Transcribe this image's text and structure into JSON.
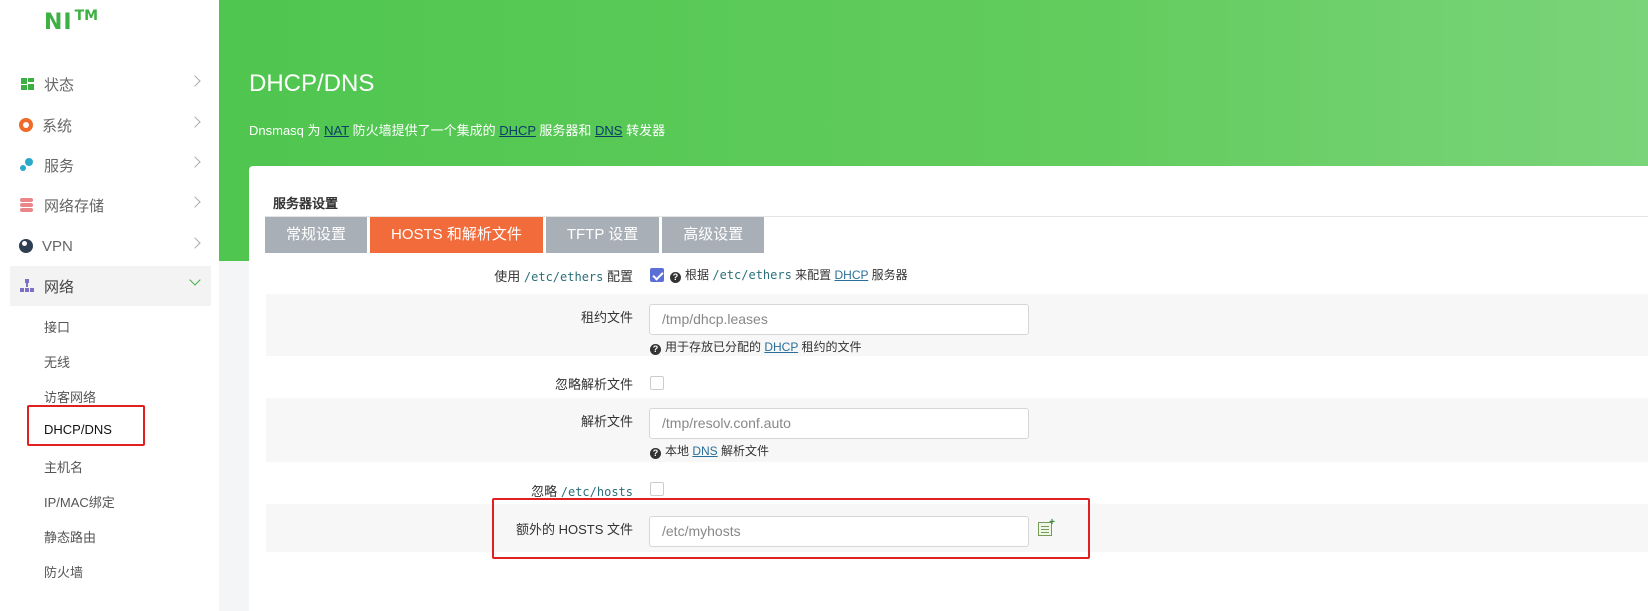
{
  "logo": {
    "text": "NI",
    "tm": "TM"
  },
  "sidebar": {
    "items": [
      {
        "label": "状态"
      },
      {
        "label": "系统"
      },
      {
        "label": "服务"
      },
      {
        "label": "网络存储"
      },
      {
        "label": "VPN"
      },
      {
        "label": "网络"
      }
    ],
    "network_sub": [
      {
        "label": "接口"
      },
      {
        "label": "无线"
      },
      {
        "label": "访客网络"
      },
      {
        "label": "DHCP/DNS"
      },
      {
        "label": "主机名"
      },
      {
        "label": "IP/MAC绑定"
      },
      {
        "label": "静态路由"
      },
      {
        "label": "防火墙"
      }
    ]
  },
  "header": {
    "title": "DHCP/DNS",
    "desc": {
      "p1": "Dnsmasq 为 ",
      "nat": "NAT",
      "p2": " 防火墙提供了一个集成的 ",
      "dhcp": "DHCP",
      "p3": " 服务器和 ",
      "dns": "DNS",
      "p4": " 转发器"
    }
  },
  "section": {
    "title": "服务器设置",
    "tabs": [
      {
        "label": "常规设置"
      },
      {
        "label": "HOSTS 和解析文件"
      },
      {
        "label": "TFTP 设置"
      },
      {
        "label": "高级设置"
      }
    ]
  },
  "form": {
    "ethers": {
      "label_pre": "使用 ",
      "label_path": "/etc/ethers",
      "label_post": " 配置",
      "help_pre": "根据 ",
      "help_path": "/etc/ethers",
      "help_mid": " 来配置 ",
      "help_link": "DHCP",
      "help_post": " 服务器",
      "checked": true
    },
    "leasefile": {
      "label": "租约文件",
      "placeholder": "/tmp/dhcp.leases",
      "help_pre": "用于存放已分配的 ",
      "help_link": "DHCP",
      "help_post": " 租约的文件"
    },
    "noresolv": {
      "label": "忽略解析文件",
      "checked": false
    },
    "resolvfile": {
      "label": "解析文件",
      "placeholder": "/tmp/resolv.conf.auto",
      "help_pre": "本地 ",
      "help_link": "DNS",
      "help_post": " 解析文件"
    },
    "nohosts": {
      "label_pre": "忽略 ",
      "label_path": "/etc/hosts",
      "checked": false
    },
    "addnhosts": {
      "label": "额外的 HOSTS 文件",
      "placeholder": "/etc/myhosts"
    }
  },
  "colors": {
    "brand_green": "#3cb043",
    "tab_active": "#f26b3a",
    "tab_inactive": "#a9afb6",
    "highlight": "#e02020"
  }
}
